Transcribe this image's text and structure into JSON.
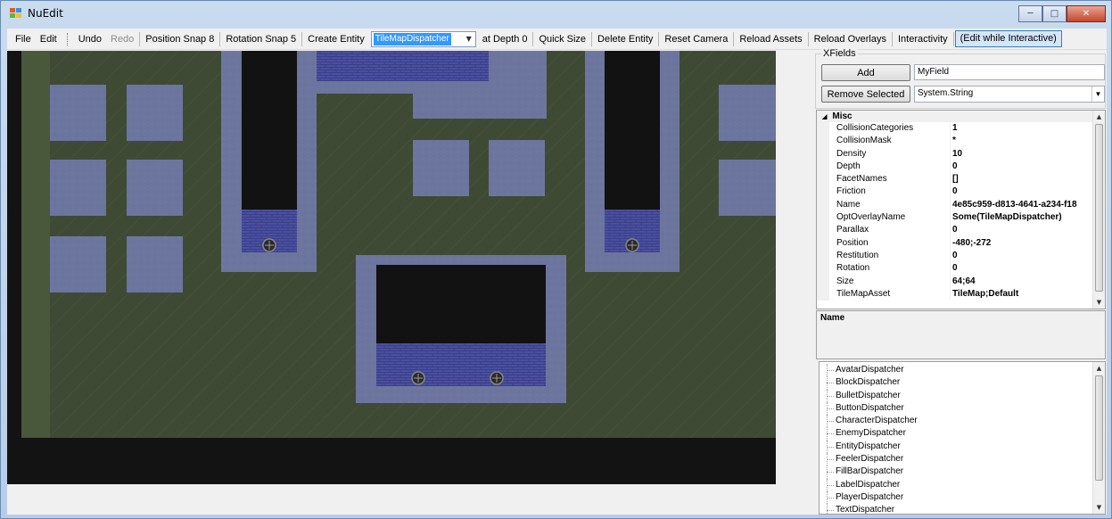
{
  "window": {
    "title": "NuEdit",
    "minimize_icon": "minimize-icon",
    "maximize_icon": "maximize-icon",
    "close_icon": "close-icon"
  },
  "menu": {
    "file": "File",
    "edit": "Edit",
    "undo": "Undo",
    "redo": "Redo",
    "position_snap_label": "Position Snap",
    "position_snap_value": "8",
    "rotation_snap_label": "Rotation Snap",
    "rotation_snap_value": "5",
    "create_entity": "Create Entity",
    "create_entity_combo_value": "TileMapDispatcher",
    "at_depth_label": "at Depth",
    "at_depth_value": "0",
    "quick_size": "Quick Size",
    "delete_entity": "Delete Entity",
    "reset_camera": "Reset Camera",
    "reload_assets": "Reload Assets",
    "reload_overlays": "Reload Overlays",
    "interactivity": "Interactivity",
    "edit_while_interactive": "(Edit while Interactive)"
  },
  "xfields": {
    "legend": "XFields",
    "add_button": "Add",
    "field_name_value": "MyField",
    "remove_button": "Remove Selected",
    "type_value": "System.String"
  },
  "property_grid": {
    "category": "Misc",
    "rows": [
      {
        "key": "CollisionCategories",
        "value": "1"
      },
      {
        "key": "CollisionMask",
        "value": "*"
      },
      {
        "key": "Density",
        "value": "10"
      },
      {
        "key": "Depth",
        "value": "0"
      },
      {
        "key": "FacetNames",
        "value": "[]"
      },
      {
        "key": "Friction",
        "value": "0"
      },
      {
        "key": "Name",
        "value": "4e85c959-d813-4641-a234-f18"
      },
      {
        "key": "OptOverlayName",
        "value": "Some(TileMapDispatcher)"
      },
      {
        "key": "Parallax",
        "value": "0"
      },
      {
        "key": "Position",
        "value": "-480;-272"
      },
      {
        "key": "Restitution",
        "value": "0"
      },
      {
        "key": "Rotation",
        "value": "0"
      },
      {
        "key": "Size",
        "value": "64;64"
      },
      {
        "key": "TileMapAsset",
        "value": "TileMap;Default"
      }
    ]
  },
  "description": {
    "title": "Name"
  },
  "dispatchers": [
    "AvatarDispatcher",
    "BlockDispatcher",
    "BulletDispatcher",
    "ButtonDispatcher",
    "CharacterDispatcher",
    "EnemyDispatcher",
    "EntityDispatcher",
    "FeelerDispatcher",
    "FillBarDispatcher",
    "LabelDispatcher",
    "PlayerDispatcher",
    "TextDispatcher"
  ],
  "colors": {
    "floor": "#3e4a34",
    "block": "#6c759e",
    "wall_border": "#5d6791",
    "pit": "#121212",
    "brick": "#4a4fa0",
    "selection": "#3399ff"
  }
}
